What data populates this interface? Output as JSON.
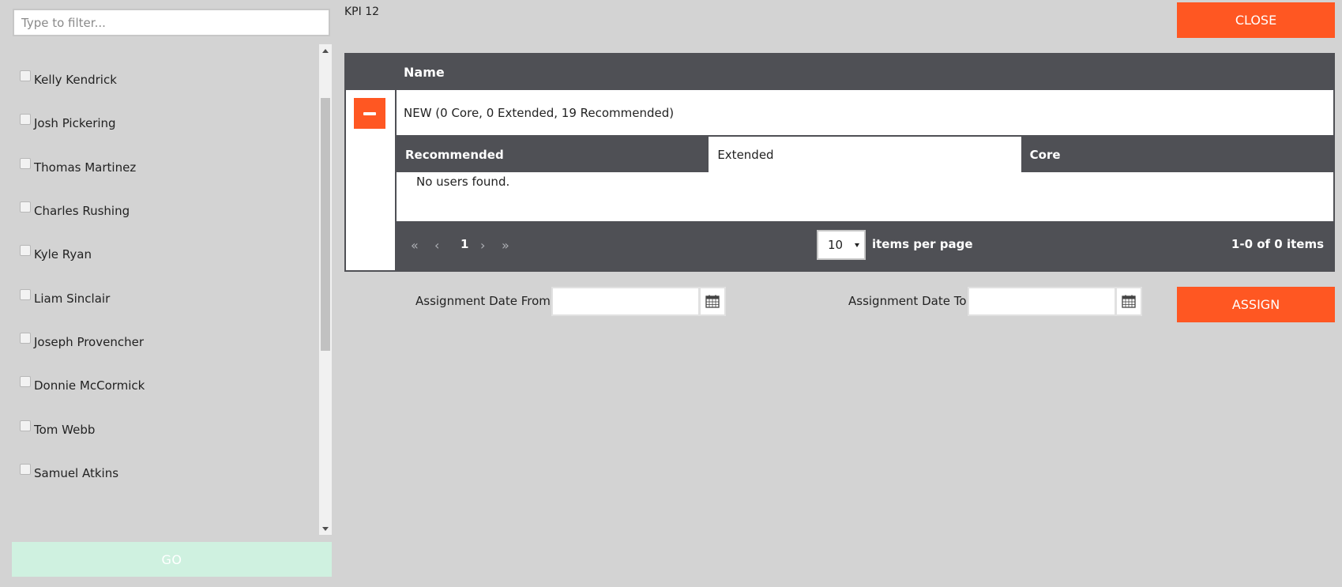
{
  "filter": {
    "placeholder": "Type to filter..."
  },
  "users": [
    {
      "label": "Kelly Kendrick",
      "checked": false
    },
    {
      "label": "Josh Pickering",
      "checked": false
    },
    {
      "label": "Thomas Martinez",
      "checked": false
    },
    {
      "label": "Charles Rushing",
      "checked": false
    },
    {
      "label": "Kyle Ryan",
      "checked": false
    },
    {
      "label": "Liam Sinclair",
      "checked": false
    },
    {
      "label": "Joseph Provencher",
      "checked": false
    },
    {
      "label": "Donnie McCormick",
      "checked": false
    },
    {
      "label": "Tom Webb",
      "checked": false
    },
    {
      "label": "Samuel Atkins",
      "checked": false
    }
  ],
  "go_label": "GO",
  "kpi_title": "KPI 12",
  "close_label": "CLOSE",
  "grid": {
    "header_name": "Name",
    "group_text": "NEW (0 Core, 0 Extended, 19 Recommended)",
    "tabs": [
      {
        "label": "Recommended",
        "selected": false
      },
      {
        "label": "Extended",
        "selected": true
      },
      {
        "label": "Core",
        "selected": false
      }
    ],
    "empty_message": "No users found.",
    "pager": {
      "current_page": "1",
      "page_size": "10",
      "items_per_page_label": "items per page",
      "count_text": "1-0 of 0 items"
    }
  },
  "assignment": {
    "from_label": "Assignment Date From",
    "to_label": "Assignment Date To",
    "from_value": "",
    "to_value": ""
  },
  "assign_label": "ASSIGN",
  "colors": {
    "accent": "#ff5722",
    "dark": "#4f5055",
    "background": "#d3d3d3",
    "go_disabled": "#cff1e0"
  }
}
